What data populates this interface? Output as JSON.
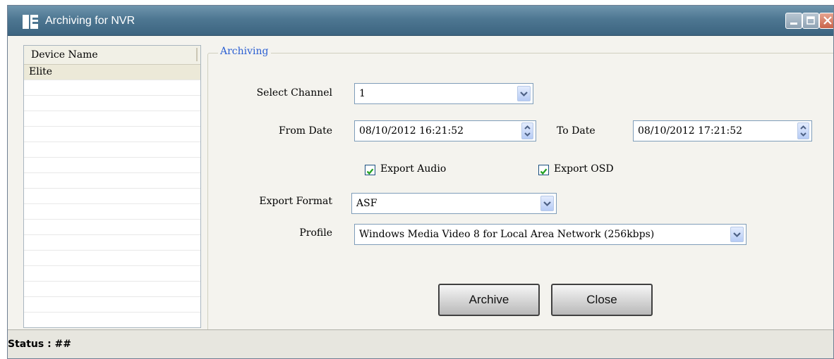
{
  "window": {
    "title": "Archiving for NVR"
  },
  "device_list": {
    "header": "Device Name",
    "items": [
      "Elite"
    ],
    "selected_index": 0
  },
  "archiving": {
    "legend": "Archiving",
    "channel_label": "Select Channel",
    "channel_value": "1",
    "from_label": "From Date",
    "from_value": "08/10/2012 16:21:52",
    "to_label": "To Date",
    "to_value": "08/10/2012 17:21:52",
    "export_audio_label": "Export Audio",
    "export_audio_checked": true,
    "export_osd_label": "Export OSD",
    "export_osd_checked": true,
    "format_label": "Export Format",
    "format_value": "ASF",
    "profile_label": "Profile",
    "profile_value": "Windows Media Video 8 for Local Area Network (256kbps)"
  },
  "buttons": {
    "archive": "Archive",
    "close": "Close"
  },
  "status": {
    "text": "Status : ##"
  },
  "icons": {
    "app": "nvr-app-icon",
    "minimize": "minimize-icon",
    "maximize": "maximize-icon",
    "close": "close-icon",
    "dropdown": "chevron-down-icon",
    "spin": "spin-up-down-icon",
    "check": "check-icon"
  },
  "colors": {
    "titlebar": "#4e7792",
    "legend": "#2b5fd2",
    "check": "#21a121"
  }
}
